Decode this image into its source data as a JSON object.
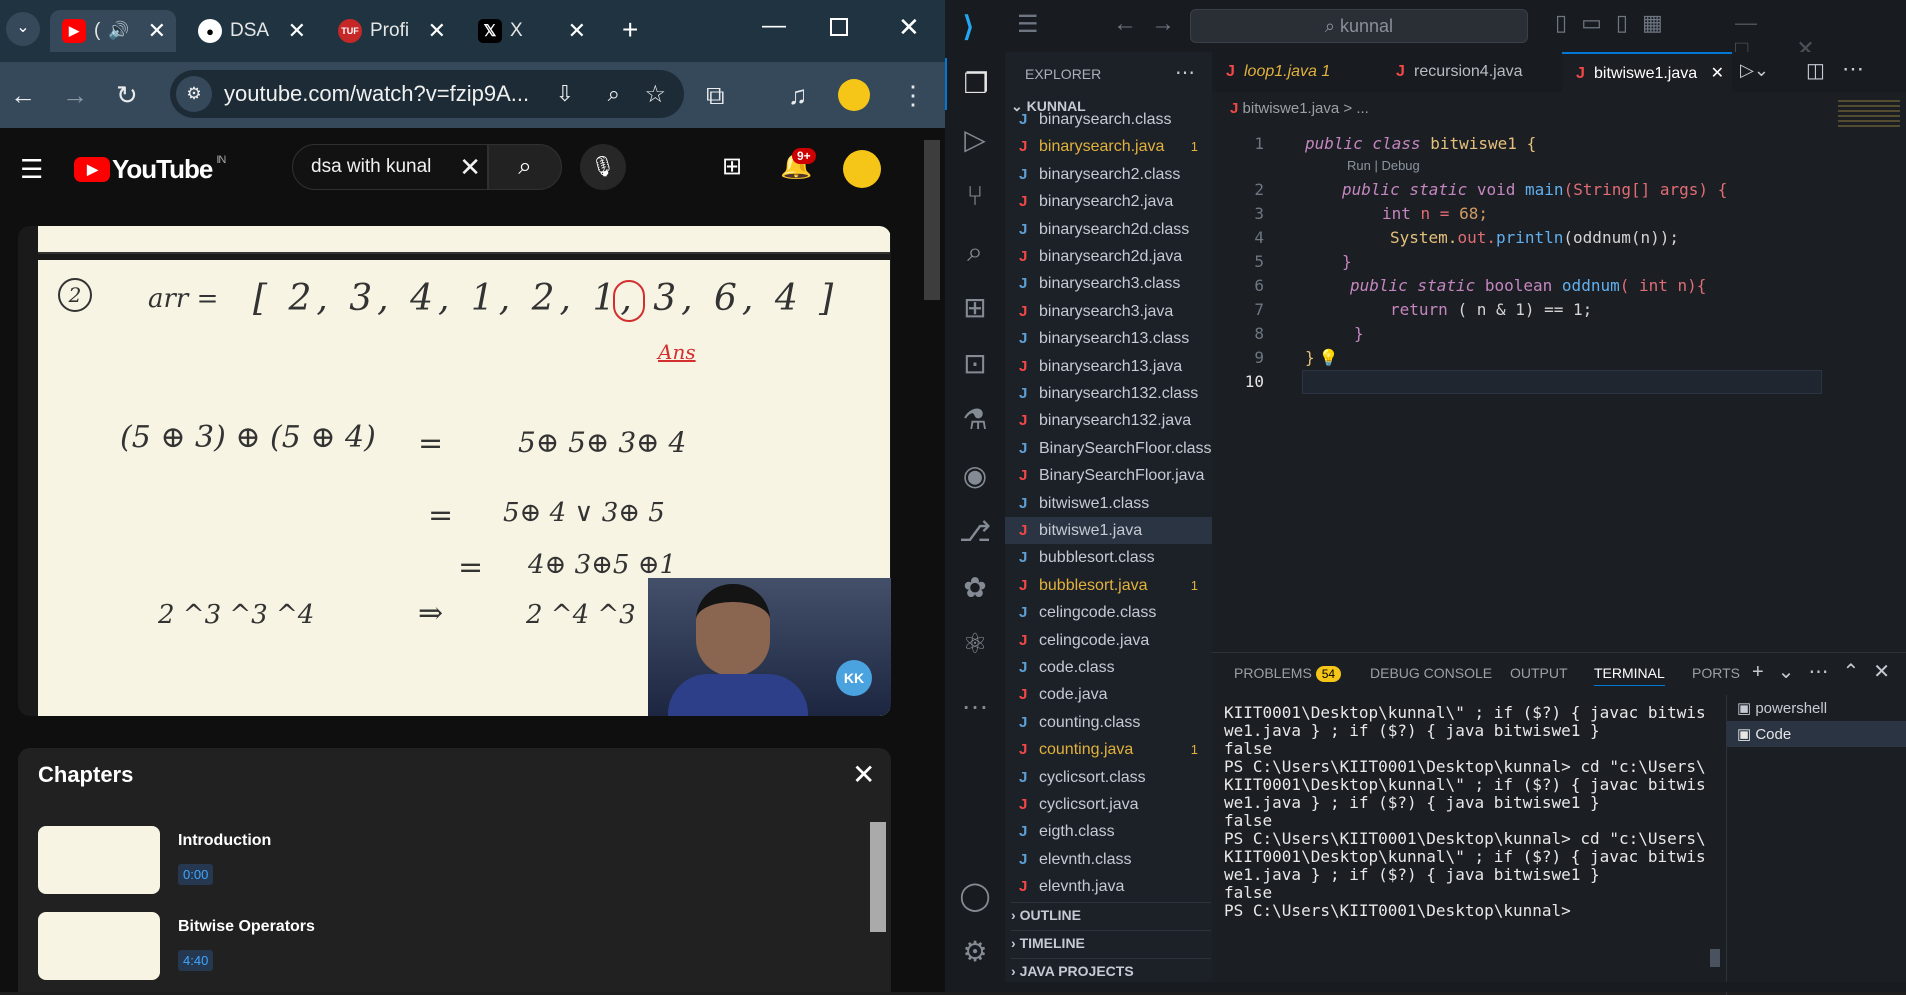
{
  "browser": {
    "tabs": [
      {
        "title": "(",
        "favicon": "youtube"
      },
      {
        "title": "DSA",
        "favicon": "github"
      },
      {
        "title": "Profi",
        "favicon": "tuf"
      },
      {
        "title": "X",
        "favicon": "x"
      }
    ],
    "url": "youtube.com/watch?v=fzip9A..."
  },
  "youtube": {
    "logo": "YouTube",
    "region": "IN",
    "search_value": "dsa with kunal",
    "notif_count": "9+",
    "whiteboard": {
      "arr": "arr =",
      "array": "[ 2, 3, 4, 1, 2, 1, 3, 6, 4 ]",
      "ans": "Ans",
      "eq1l": "(5 ⊕ 3) ⊕ (5 ⊕ 4)",
      "eq1r": "5⊕ 5⊕ 3⊕ 4",
      "eq2r": "5⊕ 4 ∨ 3⊕ 5",
      "eq3r": "4⊕ 3⊕5 ⊕1",
      "eq4l": "2 ^3 ^3 ^4",
      "arrow": "⇒",
      "eq4r": "2 ^4 ^3"
    },
    "chapters_title": "Chapters",
    "chapters": [
      {
        "title": "Introduction",
        "time": "0:00"
      },
      {
        "title": "Bitwise Operators",
        "time": "4:40"
      }
    ]
  },
  "vscode": {
    "search": "kunnal",
    "explorer_title": "EXPLORER",
    "root": "KUNNAL",
    "files": [
      {
        "name": "binarysearch.class",
        "mod": ""
      },
      {
        "name": "binarysearch.java",
        "mod": "1"
      },
      {
        "name": "binarysearch2.class",
        "mod": ""
      },
      {
        "name": "binarysearch2.java",
        "mod": ""
      },
      {
        "name": "binarysearch2d.class",
        "mod": ""
      },
      {
        "name": "binarysearch2d.java",
        "mod": ""
      },
      {
        "name": "binarysearch3.class",
        "mod": ""
      },
      {
        "name": "binarysearch3.java",
        "mod": ""
      },
      {
        "name": "binarysearch13.class",
        "mod": ""
      },
      {
        "name": "binarysearch13.java",
        "mod": ""
      },
      {
        "name": "binarysearch132.class",
        "mod": ""
      },
      {
        "name": "binarysearch132.java",
        "mod": ""
      },
      {
        "name": "BinarySearchFloor.class",
        "mod": ""
      },
      {
        "name": "BinarySearchFloor.java",
        "mod": ""
      },
      {
        "name": "bitwiswe1.class",
        "mod": ""
      },
      {
        "name": "bitwiswe1.java",
        "mod": ""
      },
      {
        "name": "bubblesort.class",
        "mod": ""
      },
      {
        "name": "bubblesort.java",
        "mod": "1"
      },
      {
        "name": "celingcode.class",
        "mod": ""
      },
      {
        "name": "celingcode.java",
        "mod": ""
      },
      {
        "name": "code.class",
        "mod": ""
      },
      {
        "name": "code.java",
        "mod": ""
      },
      {
        "name": "counting.class",
        "mod": ""
      },
      {
        "name": "counting.java",
        "mod": "1"
      },
      {
        "name": "cyclicsort.class",
        "mod": ""
      },
      {
        "name": "cyclicsort.java",
        "mod": ""
      },
      {
        "name": "eigth.class",
        "mod": ""
      },
      {
        "name": "elevnth.class",
        "mod": ""
      },
      {
        "name": "elevnth.java",
        "mod": ""
      }
    ],
    "sections": [
      "OUTLINE",
      "TIMELINE",
      "JAVA PROJECTS"
    ],
    "tabs": [
      {
        "name": "loop1.java 1"
      },
      {
        "name": "recursion4.java"
      },
      {
        "name": "bitwiswe1.java"
      }
    ],
    "breadcrumb": "bitwiswe1.java",
    "breadcrumb_more": "> ...",
    "codelens": "Run | Debug",
    "line_numbers": [
      "1",
      "2",
      "3",
      "4",
      "5",
      "6",
      "7",
      "8",
      "9",
      "10"
    ],
    "panel_tabs": [
      "PROBLEMS",
      "DEBUG CONSOLE",
      "OUTPUT",
      "TERMINAL",
      "PORTS"
    ],
    "problems_count": "54",
    "terminals": [
      "powershell",
      "Code"
    ],
    "terminal_lines": [
      "KIIT0001\\Desktop\\kunnal\\\" ; if ($?) { javac bitwis",
      "we1.java } ; if ($?) { java bitwiswe1 }",
      "false",
      "PS C:\\Users\\KIIT0001\\Desktop\\kunnal> cd \"c:\\Users\\",
      "KIIT0001\\Desktop\\kunnal\\\" ; if ($?) { javac bitwis",
      "we1.java } ; if ($?) { java bitwiswe1 }",
      "false",
      "PS C:\\Users\\KIIT0001\\Desktop\\kunnal> cd \"c:\\Users\\",
      "KIIT0001\\Desktop\\kunnal\\\" ; if ($?) { javac bitwis",
      "we1.java } ; if ($?) { java bitwiswe1 }",
      "false",
      "PS C:\\Users\\KIIT0001\\Desktop\\kunnal>"
    ],
    "code": {
      "l1a": "public class ",
      "l1b": "bitwiswe1 {",
      "l2a": "public static ",
      "l2b": "void ",
      "l2c": "main",
      "l2d": "(String[] args) {",
      "l3a": "int ",
      "l3b": "n = ",
      "l3c": "68;",
      "l4a": "System.",
      "l4b": "out.",
      "l4c": "println",
      "l4d": "(oddnum(n));",
      "l5": "}",
      "l6a": "public static ",
      "l6b": "boolean ",
      "l6c": "oddnum",
      "l6d": "( int n){",
      "l7a": "return ",
      "l7b": "( n & 1) == 1;",
      "l8": "}",
      "l9": "}"
    }
  },
  "colors": {
    "accent": "#0078d4",
    "youtube_red": "#ff0000",
    "avatar": "#f5c518"
  }
}
